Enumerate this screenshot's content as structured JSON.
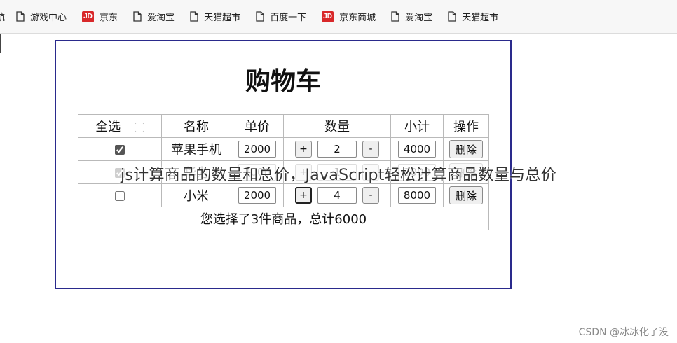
{
  "bookmarks": [
    {
      "label": "航",
      "icon": "page-icon"
    },
    {
      "label": "游戏中心",
      "icon": "page-icon"
    },
    {
      "label": "京东",
      "icon": "jd-logo-icon",
      "logo_text": "JD"
    },
    {
      "label": "爱淘宝",
      "icon": "page-icon"
    },
    {
      "label": "天猫超市",
      "icon": "page-icon"
    },
    {
      "label": "百度一下",
      "icon": "page-icon"
    },
    {
      "label": "京东商城",
      "icon": "jd-logo-icon",
      "logo_text": "JD"
    },
    {
      "label": "爱淘宝",
      "icon": "page-icon"
    },
    {
      "label": "天猫超市",
      "icon": "page-icon"
    }
  ],
  "cart": {
    "title": "购物车",
    "headers": {
      "select_all": "全选",
      "name": "名称",
      "price": "单价",
      "quantity": "数量",
      "subtotal": "小计",
      "action": "操作"
    },
    "select_all_checked": false,
    "rows": [
      {
        "checked": true,
        "name": "苹果手机",
        "price": "2000",
        "qty": "2",
        "subtotal": "4000",
        "delete": "删除",
        "plus": "+",
        "minus": "-"
      },
      {
        "checked": true,
        "name": "华为",
        "price": "2000",
        "qty": "1",
        "subtotal": "2000",
        "delete": "删除",
        "plus": "+",
        "minus": "-"
      },
      {
        "checked": false,
        "name": "小米",
        "price": "2000",
        "qty": "4",
        "subtotal": "8000",
        "delete": "删除",
        "plus": "+",
        "minus": "-"
      }
    ],
    "summary": "您选择了3件商品，总计6000"
  },
  "caption": "js计算商品的数量和总价，JavaScript轻松计算商品数量与总价",
  "watermark": "CSDN @冰冰化了没",
  "colors": {
    "frame_border": "#2a2a8c",
    "jd_red": "#d8282a"
  }
}
